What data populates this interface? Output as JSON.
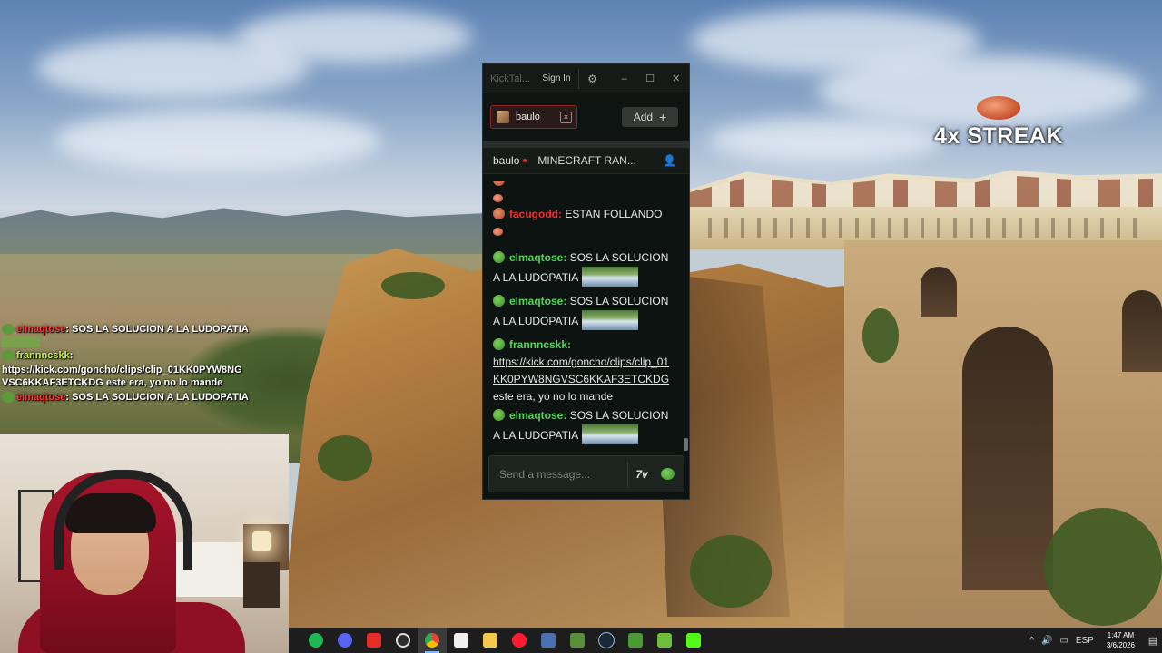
{
  "window": {
    "app_title": "KickTal...",
    "sign_in_label": "Sign In",
    "settings_icon": "gear-icon",
    "controls": {
      "minimize": "–",
      "maximize": "☐",
      "close": "✕"
    }
  },
  "tabs": [
    {
      "label": "baulo",
      "close_glyph": "×"
    }
  ],
  "add_button": {
    "label": "Add",
    "icon": "+"
  },
  "chat_header": {
    "channel": "baulo",
    "stream_title": "MINECRAFT RAN...",
    "user_icon": "user-icon"
  },
  "messages": [
    {
      "user": "facugodd",
      "text": "ESTAN FOLLANDO",
      "color": "#ef2f2f"
    },
    {
      "user": "elmaqtose",
      "text": "SOS LA SOLUCION A LA LUDOPATIA",
      "color": "#56d35a"
    },
    {
      "user": "elmaqtose",
      "text": "SOS LA SOLUCION A LA LUDOPATIA",
      "color": "#56d35a"
    },
    {
      "user": "frannncskk",
      "link": "https://kick.com/goncho/clips/clip_01KK0PYW8NGVSC6KKAF3ETCKDG",
      "text": "este era, yo no lo mande",
      "color": "#56d35a"
    },
    {
      "user": "elmaqtose",
      "text": "SOS LA SOLUCION A LA LUDOPATIA",
      "color": "#56d35a"
    }
  ],
  "input": {
    "placeholder": "Send a message...",
    "seventv_label": "7v",
    "emote_icon": "pepe-emote-icon"
  },
  "overlay": {
    "streak": "4x STREAK",
    "chat": [
      {
        "user": "elmaqtose",
        "text": ": SOS LA SOLUCION A LA LUDOPATIA"
      },
      {
        "user": "frannncskk",
        "text": ":"
      },
      {
        "link": "https://kick.com/goncho/clips/clip_01KK0PYW8NG VSC6KKAF3ETCKDG este era, yo no lo mande"
      },
      {
        "user": "elmaqtose",
        "text": ": SOS LA SOLUCION A LA LUDOPATIA"
      }
    ]
  },
  "taskbar": {
    "apps": [
      "spotify",
      "discord",
      "youtube-music",
      "obs",
      "chrome",
      "app",
      "file-explorer",
      "opera",
      "steam-app",
      "minecraft-launcher",
      "steam",
      "pepe-app",
      "minecraft",
      "kick"
    ],
    "active_app": "chrome",
    "language": "ESP",
    "time": "1:47 AM",
    "date": "3/6/2026"
  }
}
